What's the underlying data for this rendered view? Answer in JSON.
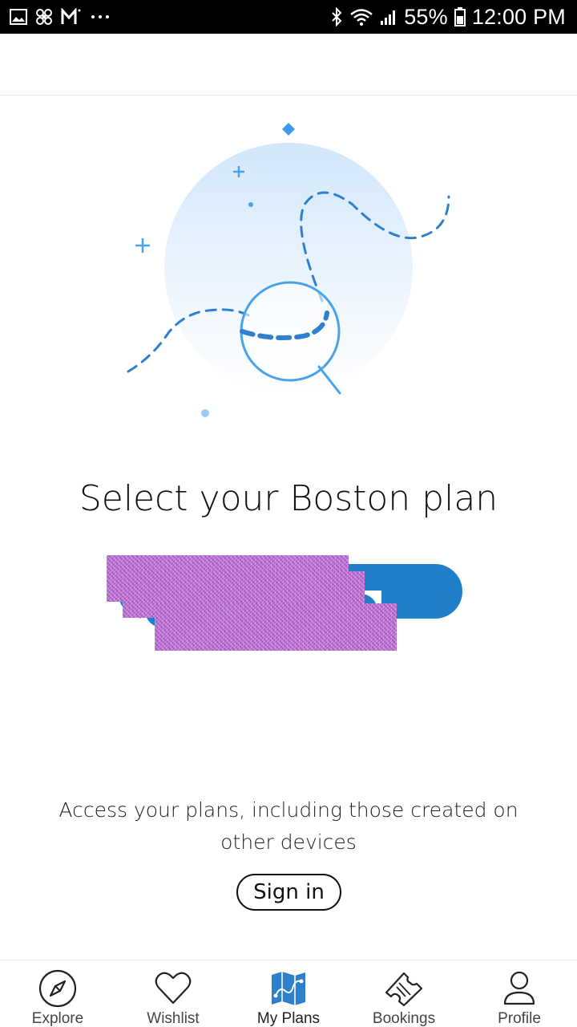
{
  "status_bar": {
    "battery": "55%",
    "time": "12:00 PM",
    "left_icons": [
      "gallery-icon",
      "fan-icon",
      "gmail-icon",
      "more-dots-icon"
    ],
    "right_icons": [
      "bluetooth-icon",
      "wifi-icon",
      "signal-icon",
      "battery-icon"
    ]
  },
  "main": {
    "title": "Select your Boston plan",
    "info_text": "Access your plans, including those created on other devices",
    "sign_in_label": "Sign in"
  },
  "bottom_nav": {
    "items": [
      {
        "label": "Explore",
        "icon": "compass-icon"
      },
      {
        "label": "Wishlist",
        "icon": "heart-icon"
      },
      {
        "label": "My Plans",
        "icon": "map-icon"
      },
      {
        "label": "Bookings",
        "icon": "ticket-icon"
      },
      {
        "label": "Profile",
        "icon": "user-icon"
      }
    ],
    "active_index": 2
  },
  "colors": {
    "accent": "#1f7fc8",
    "illustration_blue": "#3d86c6",
    "circle_fill": "#dcecfb"
  }
}
